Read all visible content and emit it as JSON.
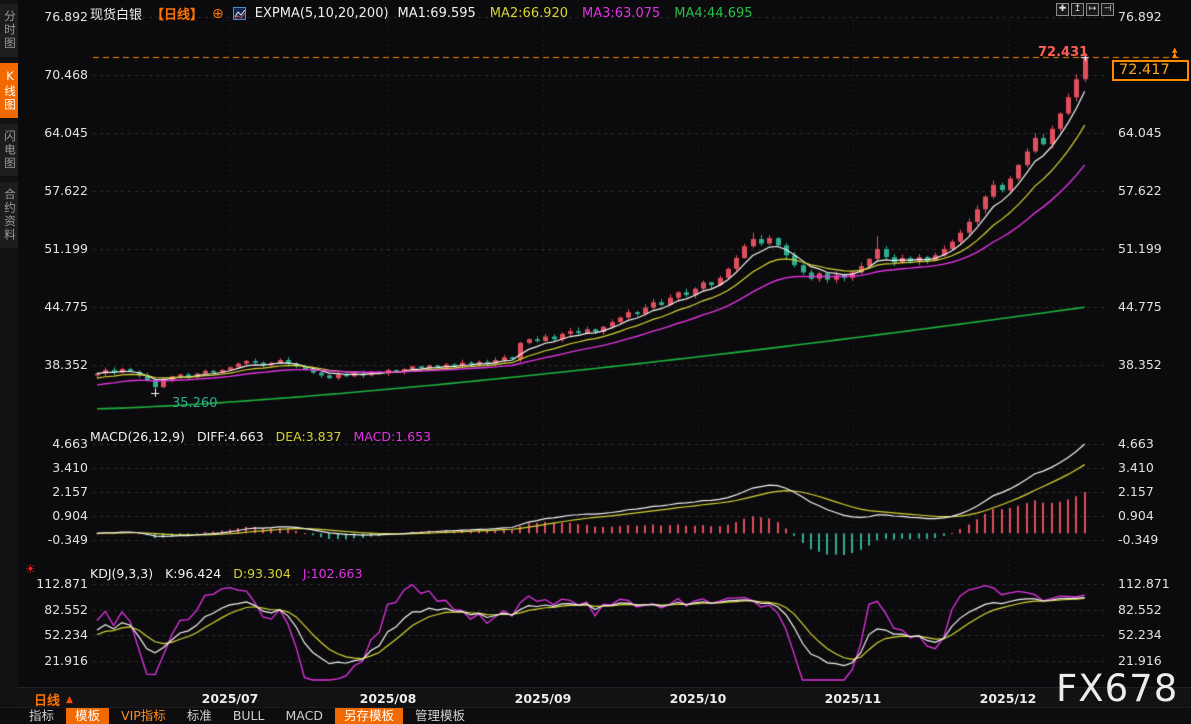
{
  "app": {
    "watermark": "FX678"
  },
  "colors": {
    "accent": "#f26900",
    "up": "#df4f5e",
    "down": "#2fae8e",
    "ma1": "#f2f2f2",
    "ma2": "#d6d333",
    "ma3": "#e233e2",
    "ma4": "#1eb33e",
    "price_line": "#ff8a00",
    "grid": "#2e2e33",
    "bg": "#0b0b0d"
  },
  "sidebar": {
    "tabs": [
      {
        "label": "分时图",
        "active": false
      },
      {
        "label": "K线图",
        "active": true
      },
      {
        "label": "闪电图",
        "active": false
      },
      {
        "label": "合约资料",
        "active": false
      }
    ]
  },
  "header": {
    "symbol": "现货白银",
    "period_tag": "【日线】",
    "add_indicator_glyph": "⊕",
    "indicator_label": "EXPMA(5,10,20,200)",
    "ma": [
      {
        "label": "MA1:69.595",
        "color": "#f2f2f2"
      },
      {
        "label": "MA2:66.920",
        "color": "#d6d333"
      },
      {
        "label": "MA3:63.075",
        "color": "#e233e2"
      },
      {
        "label": "MA4:44.695",
        "color": "#27c04a"
      }
    ],
    "icons": [
      {
        "name": "pan-move-icon",
        "glyph": "✚"
      },
      {
        "name": "expand-up-icon",
        "glyph": "↥"
      },
      {
        "name": "expand-right-icon",
        "glyph": "↦"
      },
      {
        "name": "collapse-right-icon",
        "glyph": "⊣"
      }
    ]
  },
  "price_axis": {
    "labels": [
      "76.892",
      "70.468",
      "64.045",
      "57.622",
      "51.199",
      "44.775",
      "38.352"
    ]
  },
  "annotations": {
    "high": "72.431",
    "low": "35.260",
    "current": "72.417",
    "marker_glyph": "▲"
  },
  "macd_panel": {
    "title": "MACD(26,12,9)",
    "diff_label": "DIFF:4.663",
    "dea_label": "DEA:3.837",
    "macd_label": "MACD:1.653",
    "axis": [
      "4.663",
      "3.410",
      "2.157",
      "0.904",
      "-0.349"
    ]
  },
  "kdj_panel": {
    "title": "KDJ(9,3,3)",
    "k_label": "K:96.424",
    "d_label": "D:93.304",
    "j_label": "J:102.663",
    "axis": [
      "112.871",
      "82.552",
      "52.234",
      "21.916"
    ],
    "alarm_glyph": "☀"
  },
  "x_axis": {
    "period_label": "日线",
    "arrow_glyph": "▲",
    "months": [
      "2025/07",
      "2025/08",
      "2025/09",
      "2025/10",
      "2025/11",
      "2025/12"
    ]
  },
  "bottom_bar": {
    "items": [
      {
        "label": "指标",
        "style": "plain"
      },
      {
        "label": "模板",
        "style": "orange-bg"
      },
      {
        "label": "VIP指标",
        "style": "orange-text"
      },
      {
        "label": "标准",
        "style": "plain"
      },
      {
        "label": "BULL",
        "style": "plain"
      },
      {
        "label": "MACD",
        "style": "plain"
      },
      {
        "label": "另存模板",
        "style": "orange-bg"
      },
      {
        "label": "管理模板",
        "style": "plain"
      }
    ]
  },
  "chart_data": {
    "type": "candlestick",
    "title": "现货白银 日线 (Spot Silver, daily)",
    "price_ticks": [
      76.892,
      70.468,
      64.045,
      57.622,
      51.199,
      44.775,
      38.352
    ],
    "current_price": 72.417,
    "expma": {
      "periods": [
        5,
        10,
        20,
        200
      ],
      "last": [
        69.595,
        66.92,
        63.075,
        44.695
      ]
    },
    "macd_axis": [
      4.663,
      3.41,
      2.157,
      0.904,
      -0.349
    ],
    "macd_last": {
      "diff": 4.663,
      "dea": 3.837,
      "macd": 1.653
    },
    "kdj_axis": [
      112.871,
      82.552,
      52.234,
      21.916
    ],
    "kdj_last": {
      "k": 96.424,
      "d": 93.304,
      "j": 102.663
    },
    "months": [
      "2025/07",
      "2025/08",
      "2025/09",
      "2025/10",
      "2025/11",
      "2025/12"
    ],
    "first_open": 37.2,
    "special": {
      "low_day": 7,
      "low_value": 35.26,
      "high_day": 119,
      "high_value": 72.431
    },
    "ma4": {
      "start": 33.5,
      "end": 44.75,
      "pow": 1.35
    },
    "closes": [
      37.4,
      37.8,
      37.5,
      37.9,
      37.6,
      37.2,
      36.6,
      35.9,
      36.7,
      37.1,
      37.3,
      37.0,
      37.4,
      37.7,
      37.5,
      37.8,
      38.1,
      38.5,
      38.8,
      38.6,
      38.3,
      38.6,
      38.9,
      38.5,
      38.2,
      37.8,
      37.5,
      37.2,
      36.9,
      37.3,
      37.1,
      37.4,
      37.2,
      37.6,
      37.4,
      37.8,
      37.6,
      37.9,
      38.2,
      38.0,
      38.3,
      38.1,
      38.4,
      38.2,
      38.6,
      38.4,
      38.7,
      38.5,
      38.9,
      39.2,
      39.0,
      40.8,
      41.2,
      41.0,
      41.5,
      41.2,
      41.8,
      42.1,
      41.9,
      42.3,
      42.0,
      42.6,
      43.1,
      43.6,
      44.2,
      44.0,
      44.7,
      45.3,
      45.0,
      45.8,
      46.4,
      46.1,
      46.8,
      47.5,
      47.2,
      48.0,
      49.0,
      50.2,
      51.5,
      52.3,
      51.8,
      52.4,
      51.6,
      50.5,
      49.4,
      48.6,
      47.9,
      48.5,
      47.8,
      48.3,
      48.0,
      48.6,
      49.3,
      50.1,
      51.2,
      50.3,
      49.7,
      50.2,
      49.8,
      50.3,
      49.9,
      50.5,
      51.2,
      52.0,
      53.0,
      54.2,
      55.6,
      57.0,
      58.3,
      57.7,
      59.0,
      60.5,
      62.0,
      63.5,
      62.8,
      64.5,
      66.2,
      68.0,
      70.0,
      72.417
    ]
  }
}
